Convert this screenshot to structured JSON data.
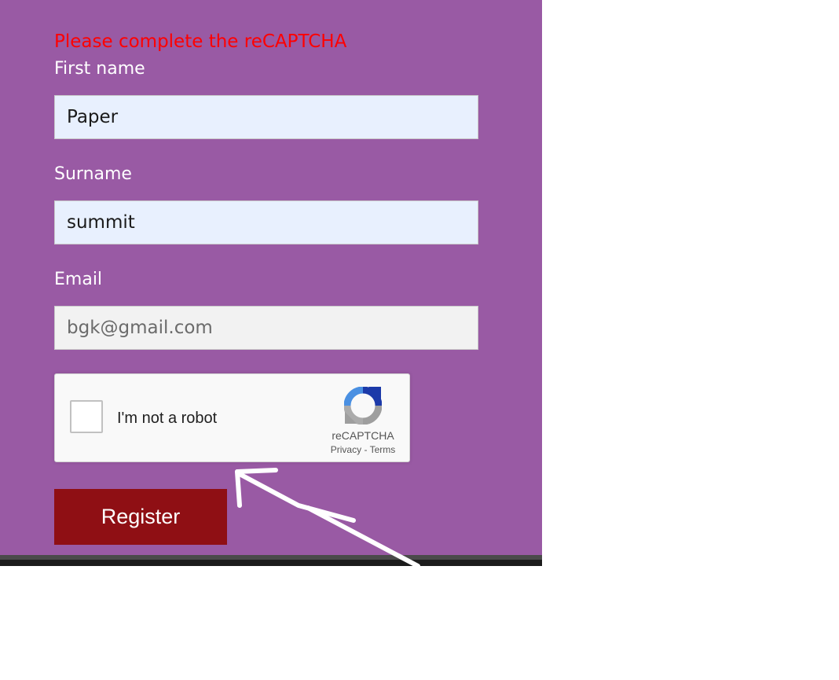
{
  "form": {
    "error_message": "Please complete the reCAPTCHA",
    "first_name": {
      "label": "First name",
      "value": "Paper"
    },
    "surname": {
      "label": "Surname",
      "value": "summit"
    },
    "email": {
      "label": "Email",
      "placeholder": "bgk@gmail.com"
    },
    "register_label": "Register"
  },
  "recaptcha": {
    "checkbox_label": "I'm not a robot",
    "brand": "reCAPTCHA",
    "privacy_link": "Privacy",
    "separator": "-",
    "terms_link": "Terms"
  },
  "colors": {
    "panel_background": "#995aa4",
    "error_text": "#ff0000",
    "register_button": "#8f0f14",
    "autofill_field": "#e8f0fe",
    "annotation_arrow": "#ffffff"
  },
  "icons": [
    "recaptcha-logo-icon",
    "hand-drawn-arrow-annotation"
  ]
}
